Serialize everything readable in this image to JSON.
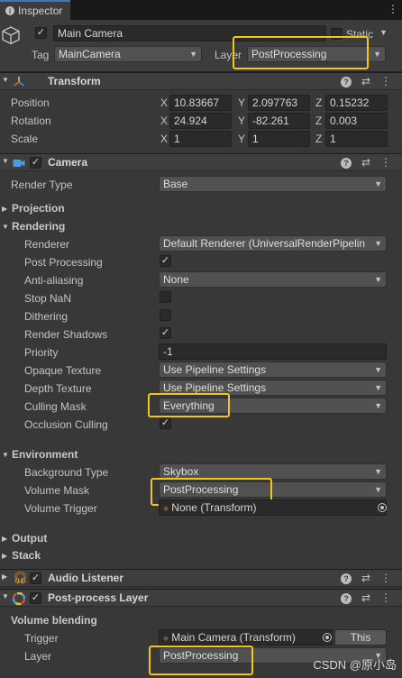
{
  "tab": {
    "title": "Inspector",
    "menu_icon": "kebab-menu-icon"
  },
  "object": {
    "name": "Main Camera",
    "active": true,
    "static_label": "Static",
    "tag_label": "Tag",
    "tag_value": "MainCamera",
    "layer_label": "Layer",
    "layer_value": "PostProcessing"
  },
  "transform": {
    "title": "Transform",
    "rows": [
      {
        "label": "Position",
        "x": "10.83667",
        "y": "2.097763",
        "z": "0.15232"
      },
      {
        "label": "Rotation",
        "x": "24.924",
        "y": "-82.261",
        "z": "0.003"
      },
      {
        "label": "Scale",
        "x": "1",
        "y": "1",
        "z": "1"
      }
    ],
    "axis_x": "X",
    "axis_y": "Y",
    "axis_z": "Z"
  },
  "camera": {
    "title": "Camera",
    "render_type_label": "Render Type",
    "render_type_value": "Base",
    "projection_label": "Projection",
    "rendering_label": "Rendering",
    "renderer_label": "Renderer",
    "renderer_value": "Default Renderer (UniversalRenderPipelin",
    "post_processing_label": "Post Processing",
    "anti_aliasing_label": "Anti-aliasing",
    "anti_aliasing_value": "None",
    "stop_nan_label": "Stop NaN",
    "dithering_label": "Dithering",
    "render_shadows_label": "Render Shadows",
    "priority_label": "Priority",
    "priority_value": "-1",
    "opaque_texture_label": "Opaque Texture",
    "opaque_texture_value": "Use Pipeline Settings",
    "depth_texture_label": "Depth Texture",
    "depth_texture_value": "Use Pipeline Settings",
    "culling_mask_label": "Culling Mask",
    "culling_mask_value": "Everything",
    "occlusion_culling_label": "Occlusion Culling",
    "environment_label": "Environment",
    "background_type_label": "Background Type",
    "background_type_value": "Skybox",
    "volume_mask_label": "Volume Mask",
    "volume_mask_value": "PostProcessing",
    "volume_trigger_label": "Volume Trigger",
    "volume_trigger_value": "None (Transform)",
    "output_label": "Output",
    "stack_label": "Stack"
  },
  "audio_listener": {
    "title": "Audio Listener"
  },
  "post_process_layer": {
    "title": "Post-process Layer",
    "volume_blending_label": "Volume blending",
    "trigger_label": "Trigger",
    "trigger_value": "Main Camera (Transform)",
    "this_button": "This",
    "layer_label": "Layer",
    "layer_value": "PostProcessing"
  },
  "watermark": "CSDN @原小岛",
  "colors": {
    "highlight": "#f5c518",
    "background": "#383838",
    "field": "#2a2a2a",
    "dropdown": "#515151"
  }
}
